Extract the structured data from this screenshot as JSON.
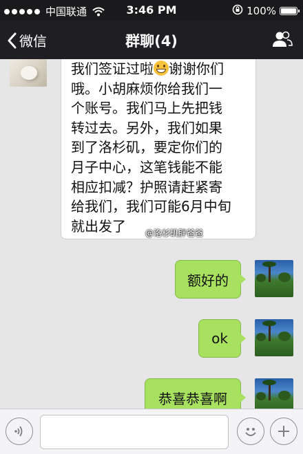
{
  "status_bar": {
    "carrier": "中国联通",
    "time": "3:46 PM",
    "battery": "100%",
    "battery_level": 1.0
  },
  "nav": {
    "back_label": "微信",
    "title": "群聊(4)",
    "right_icon": "group-members-icon"
  },
  "messages": [
    {
      "side": "left",
      "lines": [
        "我们签证过啦",
        "哦。小胡麻烦你给我们一",
        "个账号。我们马上先把钱",
        "转过去。另外，我们如果",
        "到了洛杉矶，要定你们的",
        "月子中心，这笔钱能不能",
        "相应扣减？护照请赶紧寄",
        "给我们，我们可能6月中旬",
        "就出发了"
      ],
      "line1_after_emoji": "谢谢你们",
      "emoji": "grinning-face-emoji"
    },
    {
      "side": "right",
      "text": "额好的"
    },
    {
      "side": "right",
      "text": "ok"
    },
    {
      "side": "right",
      "text": "恭喜恭喜啊"
    }
  ],
  "watermark": "@洛杉矶胖爸爸",
  "input_bar": {
    "voice_icon": "voice-icon",
    "emoji_icon": "emoji-icon",
    "plus_icon": "plus-icon",
    "input_value": ""
  },
  "colors": {
    "nav_bg": "#1f1f23",
    "chat_bg": "#e6e6e6",
    "bubble_right": "#a8e05f",
    "bubble_left": "#ffffff"
  }
}
